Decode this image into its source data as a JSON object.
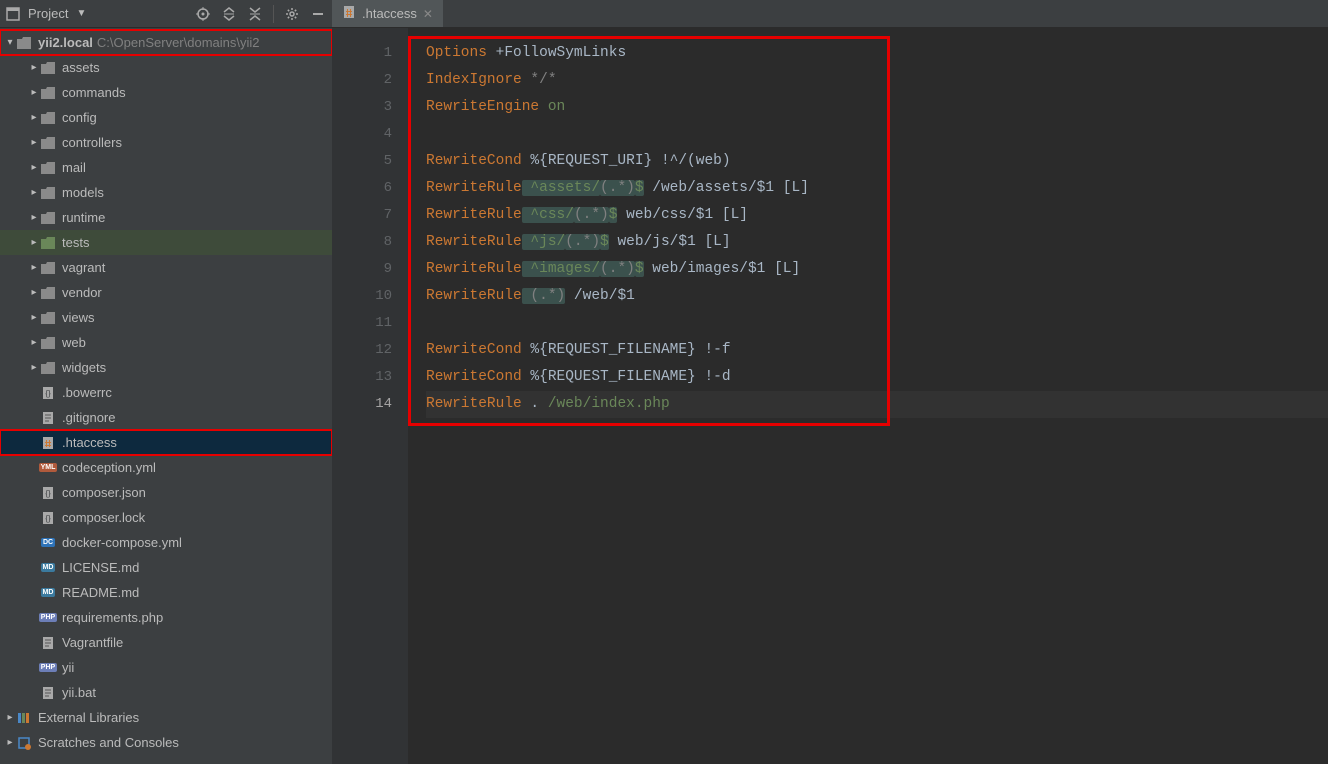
{
  "toolbar": {
    "project_label": "Project"
  },
  "tab": {
    "label": ".htaccess"
  },
  "tree": {
    "root_name": "yii2.local",
    "root_path": "C:\\OpenServer\\domains\\yii2",
    "folders": {
      "assets": "assets",
      "commands": "commands",
      "config": "config",
      "controllers": "controllers",
      "mail": "mail",
      "models": "models",
      "runtime": "runtime",
      "tests": "tests",
      "vagrant": "vagrant",
      "vendor": "vendor",
      "views": "views",
      "web": "web",
      "widgets": "widgets"
    },
    "files": {
      "bowerrc": ".bowerrc",
      "gitignore": ".gitignore",
      "htaccess": ".htaccess",
      "codeception": "codeception.yml",
      "composer_json": "composer.json",
      "composer_lock": "composer.lock",
      "docker": "docker-compose.yml",
      "license": "LICENSE.md",
      "readme": "README.md",
      "requirements": "requirements.php",
      "vagrantfile": "Vagrantfile",
      "yii": "yii",
      "yii_bat": "yii.bat"
    },
    "external_libs": "External Libraries",
    "scratches": "Scratches and Consoles"
  },
  "gutter": {
    "lines": [
      "1",
      "2",
      "3",
      "4",
      "5",
      "6",
      "7",
      "8",
      "9",
      "10",
      "11",
      "12",
      "13",
      "14"
    ]
  },
  "code": {
    "l1_a": "Options",
    "l1_b": " +FollowSymLinks",
    "l2_a": "IndexIgnore",
    "l2_b": " */*",
    "l3_a": "RewriteEngine",
    "l3_b": " on",
    "l5_a": "RewriteCond",
    "l5_b": " %{REQUEST_URI} !^/(web)",
    "l6_a": "RewriteRule",
    "l6_b": " ^assets/",
    "l6_c": "(.*)",
    "l6_d": "$",
    "l6_e": " /web/assets/$1 [L]",
    "l7_a": "RewriteRule",
    "l7_b": " ^css/",
    "l7_c": "(.*)",
    "l7_d": "$",
    "l7_e": " web/css/$1 [L]",
    "l8_a": "RewriteRule",
    "l8_b": " ^js/",
    "l8_c": "(.*)",
    "l8_d": "$",
    "l8_e": " web/js/$1 [L]",
    "l9_a": "RewriteRule",
    "l9_b": " ^images/",
    "l9_c": "(.*)",
    "l9_d": "$",
    "l9_e": " web/images/$1 [L]",
    "l10_a": "RewriteRule",
    "l10_b": " (.*)",
    "l10_c": " /web/$1",
    "l12_a": "RewriteCond",
    "l12_b": " %{REQUEST_FILENAME} !-f",
    "l13_a": "RewriteCond",
    "l13_b": " %{REQUEST_FILENAME} !-d",
    "l14_a": "RewriteRule",
    "l14_b": " .",
    "l14_c": " /web/index.php"
  }
}
